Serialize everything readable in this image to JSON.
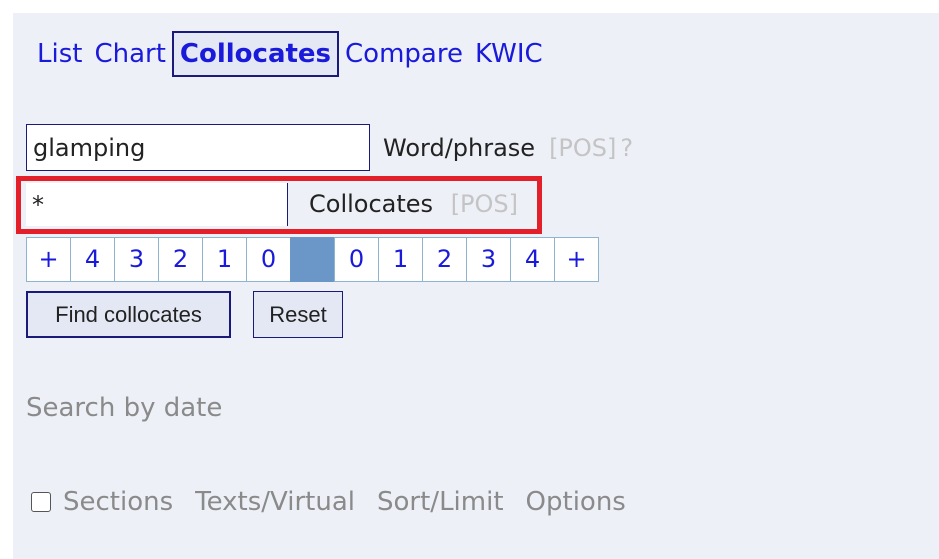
{
  "tabs": [
    {
      "label": "List"
    },
    {
      "label": "Chart"
    },
    {
      "label": "Collocates"
    },
    {
      "label": "Compare"
    },
    {
      "label": "KWIC"
    }
  ],
  "word": {
    "value": "glamping",
    "label": "Word/phrase",
    "pos": "[POS]",
    "help": "?"
  },
  "collocates": {
    "value": "*",
    "label": "Collocates",
    "pos": "[POS]"
  },
  "span": {
    "left": [
      "+",
      "4",
      "3",
      "2",
      "1",
      "0"
    ],
    "right": [
      "0",
      "1",
      "2",
      "3",
      "4",
      "+"
    ]
  },
  "buttons": {
    "find": "Find collocates",
    "reset": "Reset"
  },
  "search_by_date": "Search by date",
  "bottom": {
    "sections": "Sections",
    "texts": "Texts/Virtual",
    "sort": "Sort/Limit",
    "options": "Options"
  }
}
